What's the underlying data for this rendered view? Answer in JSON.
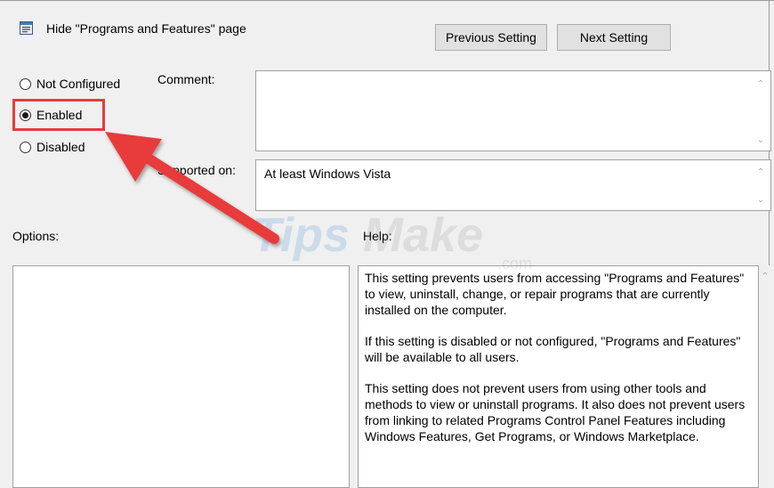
{
  "window": {
    "title": "Hide \"Programs and Features\" page",
    "title_icon": "policy-setting-icon"
  },
  "navigation": {
    "previous_label": "Previous Setting",
    "next_label": "Next Setting"
  },
  "state_options": [
    {
      "label": "Not Configured",
      "selected": false
    },
    {
      "label": "Enabled",
      "selected": true
    },
    {
      "label": "Disabled",
      "selected": false
    }
  ],
  "labels": {
    "comment": "Comment:",
    "supported_on": "Supported on:",
    "options": "Options:",
    "help": "Help:"
  },
  "fields": {
    "comment_value": "",
    "supported_on_value": "At least Windows Vista"
  },
  "help_paragraphs": [
    "This setting prevents users from accessing \"Programs and Features\" to view, uninstall, change, or repair programs that are currently installed on the computer.",
    "If this setting is disabled or not configured, \"Programs and Features\" will be available to all users.",
    "This setting does not prevent users from using other tools and methods to view or uninstall programs.  It also does not prevent users from linking to related Programs Control Panel Features including Windows Features, Get Programs, or Windows Marketplace."
  ],
  "watermark": {
    "text_a": "Tips",
    "text_b": "Make",
    "text_c": ".com"
  },
  "annotation": {
    "color": "#e83b3b",
    "arrow_icon": "red-arrow-icon"
  }
}
